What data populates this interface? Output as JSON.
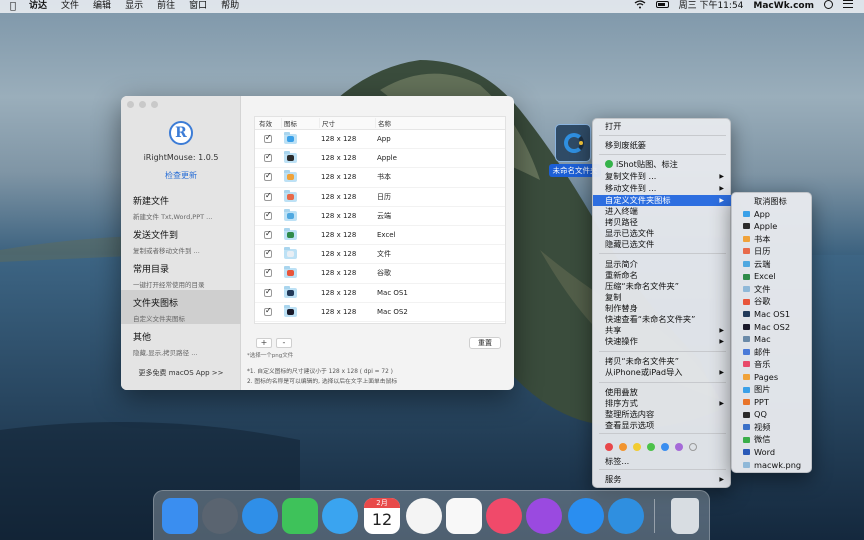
{
  "menubar": {
    "apple": "",
    "items": [
      "访达",
      "文件",
      "编辑",
      "显示",
      "前往",
      "窗口",
      "帮助"
    ],
    "clock": "周三 下午11:54",
    "site": "MacWk.com"
  },
  "app": {
    "logo_letter": "R",
    "version": "iRightMouse: 1.0.5",
    "check_update": "检查更新",
    "sections": [
      {
        "title": "新建文件",
        "subtitle": "新建文件 Txt,Word,PPT ..."
      },
      {
        "title": "发送文件到",
        "subtitle": "复制或者移动文件到 ..."
      },
      {
        "title": "常用目录",
        "subtitle": "一键打开经常使用的目录"
      },
      {
        "title": "文件夹图标",
        "subtitle": "自定义文件夹图标"
      },
      {
        "title": "其他",
        "subtitle": "隐藏,显示,拷贝路径 ..."
      }
    ],
    "more_apps": "更多免费 macOS App >>",
    "table": {
      "headers": [
        "有效",
        "图标",
        "尺寸",
        "名称"
      ],
      "rows": [
        {
          "size": "128 x 128",
          "name": "App",
          "color": "#3aa0e8"
        },
        {
          "size": "128 x 128",
          "name": "Apple",
          "color": "#2b2b2b"
        },
        {
          "size": "128 x 128",
          "name": "书本",
          "color": "#f0a23a"
        },
        {
          "size": "128 x 128",
          "name": "日历",
          "color": "#e86a4a"
        },
        {
          "size": "128 x 128",
          "name": "云端",
          "color": "#4fa8e0"
        },
        {
          "size": "128 x 128",
          "name": "Excel",
          "color": "#2e8b4a"
        },
        {
          "size": "128 x 128",
          "name": "文件",
          "color": "#e8eef4"
        },
        {
          "size": "128 x 128",
          "name": "谷歌",
          "color": "#e8553a"
        },
        {
          "size": "128 x 128",
          "name": "Mac OS1",
          "color": "#223a5a"
        },
        {
          "size": "128 x 128",
          "name": "Mac OS2",
          "color": "#1a1a2a"
        }
      ]
    },
    "buttons": {
      "add": "+",
      "remove": "-",
      "reset": "重置"
    },
    "hint": "*选择一个png文件",
    "note1": "*1. 自定义图标的尺寸建议小于 128 x 128 ( dpi = 72 )",
    "note2": "2. 图标的名称是可以编辑的, 选择以后在文字上面单击鼠标"
  },
  "desktop_folder": {
    "label": "未命名文件夹"
  },
  "context_menu": {
    "items": [
      {
        "label": "打开",
        "arrow": false
      },
      {
        "label": "移到废纸篓",
        "arrow": false
      },
      {
        "label": "iShot贴图、标注",
        "arrow": false
      },
      {
        "label": "复制文件到 ...",
        "arrow": true
      },
      {
        "label": "移动文件到 ...",
        "arrow": true
      },
      {
        "label": "自定义文件夹图标",
        "arrow": true
      },
      {
        "label": "进入终端",
        "arrow": false
      },
      {
        "label": "拷贝路径",
        "arrow": false
      },
      {
        "label": "显示已选文件",
        "arrow": false
      },
      {
        "label": "隐藏已选文件",
        "arrow": false
      },
      {
        "label": "显示简介",
        "arrow": false
      },
      {
        "label": "重新命名",
        "arrow": false
      },
      {
        "label": "压缩“未命名文件夹”",
        "arrow": false
      },
      {
        "label": "复制",
        "arrow": false
      },
      {
        "label": "制作替身",
        "arrow": false
      },
      {
        "label": "快速查看“未命名文件夹”",
        "arrow": false
      },
      {
        "label": "共享",
        "arrow": true
      },
      {
        "label": "快速操作",
        "arrow": true
      },
      {
        "label": "拷贝“未命名文件夹”",
        "arrow": false
      },
      {
        "label": "从iPhone或iPad导入",
        "arrow": true
      },
      {
        "label": "使用叠放",
        "arrow": false
      },
      {
        "label": "排序方式",
        "arrow": true
      },
      {
        "label": "整理所选内容",
        "arrow": false
      },
      {
        "label": "查看显示选项",
        "arrow": false
      },
      {
        "label": "标签...",
        "arrow": false
      },
      {
        "label": "服务",
        "arrow": true
      }
    ],
    "highlighted": "自定义文件夹图标",
    "tag_colors": [
      "#e8474a",
      "#f2942e",
      "#f2cc32",
      "#4cc24a",
      "#3a8ef0",
      "#a56ad8",
      "#9a9a9a"
    ]
  },
  "submenu": {
    "items": [
      {
        "label": "取消图标",
        "icon": ""
      },
      {
        "label": "App",
        "color": "#3aa0e8"
      },
      {
        "label": "Apple",
        "color": "#2b2b2b"
      },
      {
        "label": "书本",
        "color": "#f0a23a"
      },
      {
        "label": "日历",
        "color": "#e86a4a"
      },
      {
        "label": "云端",
        "color": "#4fa8e0"
      },
      {
        "label": "Excel",
        "color": "#2e8b4a"
      },
      {
        "label": "文件",
        "color": "#8fb8d8"
      },
      {
        "label": "谷歌",
        "color": "#e8553a"
      },
      {
        "label": "Mac OS1",
        "color": "#223a5a"
      },
      {
        "label": "Mac OS2",
        "color": "#1a1a2a"
      },
      {
        "label": "Mac",
        "color": "#6a8aa8"
      },
      {
        "label": "邮件",
        "color": "#4a7ad8"
      },
      {
        "label": "音乐",
        "color": "#e84a6a"
      },
      {
        "label": "Pages",
        "color": "#f0a23a"
      },
      {
        "label": "图片",
        "color": "#3aa0e8"
      },
      {
        "label": "PPT",
        "color": "#e8742a"
      },
      {
        "label": "QQ",
        "color": "#2a2a2a"
      },
      {
        "label": "视频",
        "color": "#3a70c8"
      },
      {
        "label": "微信",
        "color": "#3aae4a"
      },
      {
        "label": "Word",
        "color": "#2a5ab8"
      },
      {
        "label": "macwk.png",
        "color": "#8fb8d8"
      }
    ]
  },
  "dock": {
    "apps": [
      {
        "name": "finder",
        "color": "#3a8ef0"
      },
      {
        "name": "launchpad",
        "color": "#5a6470"
      },
      {
        "name": "safari",
        "color": "#2f8fe8"
      },
      {
        "name": "facetime",
        "color": "#3ec25a"
      },
      {
        "name": "messages",
        "color": "#3aa4f0"
      },
      {
        "name": "calendar",
        "color": "#ffffff"
      },
      {
        "name": "photos",
        "color": "#f4f4f4"
      },
      {
        "name": "reminders",
        "color": "#f8f8f8"
      },
      {
        "name": "music",
        "color": "#f04a6a"
      },
      {
        "name": "podcasts",
        "color": "#9a4ae0"
      },
      {
        "name": "app-store",
        "color": "#2a8ef0"
      },
      {
        "name": "irightmouse",
        "color": "#2f8fe0"
      },
      {
        "name": "trash",
        "color": "#d8dde2"
      }
    ],
    "calendar_month": "2月",
    "calendar_day": "12"
  }
}
